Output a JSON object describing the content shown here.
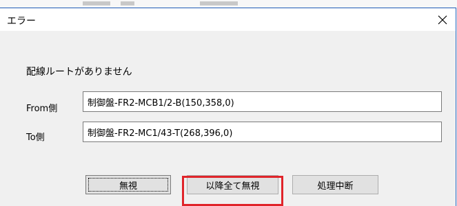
{
  "dialog": {
    "title": "エラー",
    "message": "配線ルートがありません"
  },
  "fields": {
    "from_label": "From側",
    "from_value": "制御盤-FR2-MCB1/2-B(150,358,0)",
    "to_label": "To側",
    "to_value": "制御盤-FR2-MC1/43-T(268,396,0)"
  },
  "buttons": {
    "ignore": "無視",
    "ignore_all": "以降全て無視",
    "abort": "処理中断"
  },
  "colors": {
    "highlight": "#e0242a",
    "window_border": "#1e5bb5"
  },
  "icons": {
    "close": "close-icon"
  }
}
